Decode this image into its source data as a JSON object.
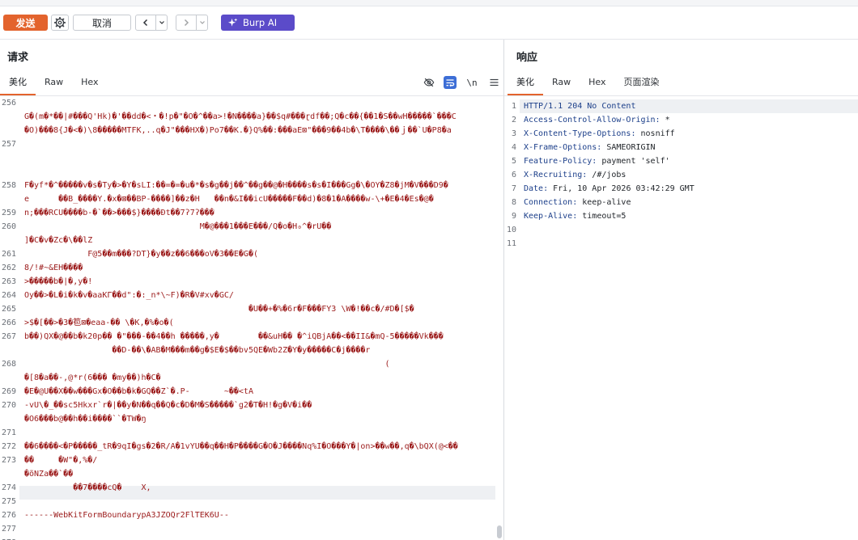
{
  "toolbar": {
    "send_label": "发送",
    "cancel_label": "取消",
    "burp_ai_label": "Burp AI"
  },
  "request": {
    "title": "请求",
    "tabs": [
      {
        "label": "美化",
        "active": true
      },
      {
        "label": "Raw",
        "active": false
      },
      {
        "label": "Hex",
        "active": false
      }
    ],
    "newline_toggle": "\\n",
    "rows": [
      {
        "num": "256",
        "text": ""
      },
      {
        "num": "",
        "text": "G�(m�*��|#���Q'Hk)�'��dd�<・�!p�\"�O�^��a>!�N����a}��$q#���ɽdf��;Q�c��{��1�S��wH�����`���C"
      },
      {
        "num": "",
        "text": "�O)���8{J�<�)\\8�����MTFK,..q�J\"���HX�)Po7��K.�}Q%��:���aE⊠\"���9��4b�\\T����\\��ｊ��`U�P8�a"
      },
      {
        "num": "257",
        "text": ""
      },
      {
        "num": "",
        "text": ""
      },
      {
        "num": "",
        "text": ""
      },
      {
        "num": "258",
        "text": "F�yf*�^�����v�s�Ty�>�Y�sLI:��=�=�u�*�s�g��j��^��g��@�H����s�s�I���Gg�\\�OY�Z8�jM�V���D9�"
      },
      {
        "num": "",
        "text": "e      ��B_����Y.�x�⊠��BP-����]��z�H   ��n�&I��icU�����F��d)�8�1�A����w-\\+�E�4�Es�@�"
      },
      {
        "num": "259",
        "text": "n;���RCU����b-�`��>���$}����Ðt��7ʔ7ʔ���"
      },
      {
        "num": "260",
        "text": "                                    M�@���1���E���/Q�o�H₀^�rU��"
      },
      {
        "num": "",
        "text": "]�C�v�Zc�\\��lZ"
      },
      {
        "num": "261",
        "text": "             F@5��m���?DT}�y��z��6���oV�3��E�G�("
      },
      {
        "num": "262",
        "text": "8/!#~&EH����"
      },
      {
        "num": "263",
        "text": ">�����b�|�,y�!"
      },
      {
        "num": "264",
        "text": "Oy��>�L�i�k�v�aaKΓ��d\":�:_n*\\~F)�R�V#xv�GC/"
      },
      {
        "num": "265",
        "text": "                                              �U��+�%�6r�F���FY3 \\W�!��c�/#D�[$�"
      },
      {
        "num": "266",
        "text": ">$�[��>�3�笣⊠�eaa-�� \\�K,�%�o�("
      },
      {
        "num": "267",
        "text": "b��)QX�@��b�k20p�� �\"���-��4��h �����,y�        ��&uH�� �^iQBjA��<��II&�mQ-5�����Vk���"
      },
      {
        "num": "",
        "text": "                  ��D-��\\�AB�M���m��g�$E�$��bv5QE�Wb2Z�Y�y�����C�j����r"
      },
      {
        "num": "268",
        "text": "                                                                          ("
      },
      {
        "num": "",
        "text": "�[8�a��-,@*r(6��� �my��)h�C�"
      },
      {
        "num": "269",
        "text": "�E�@U��X��w���Gx�O��b�k�GQ��Z`�.P-       ~��<tA"
      },
      {
        "num": "270",
        "text": "-vU\\�_��sc5Hkxr`r�|��y�N��q��Q�c�D�M�S�����`g2�T�H!�g�V�i��"
      },
      {
        "num": "",
        "text": "�O6���b@��h��i����``�TW�ŋ"
      },
      {
        "num": "271",
        "text": ""
      },
      {
        "num": "272",
        "text": "��6����<�P�����_tR�9qI�gs�2�R/A�1vYU��q��H�P����G�O�J����Nq%I�O���Y�|on>��w��,q�\\bQX(@<��"
      },
      {
        "num": "273",
        "text": "��     �W\"�,%�/"
      },
      {
        "num": "",
        "text": "�õNZa��`��"
      },
      {
        "num": "274",
        "text": "          ��7����cQ�    X,"
      },
      {
        "num": "275",
        "text": ""
      },
      {
        "num": "276",
        "text": "------WebKitFormBoundarypA3JZOQr2FlTEK6U--"
      },
      {
        "num": "277",
        "text": ""
      },
      {
        "num": "278",
        "text": ""
      }
    ]
  },
  "response": {
    "title": "响应",
    "tabs": [
      {
        "label": "美化",
        "active": true
      },
      {
        "label": "Raw",
        "active": false
      },
      {
        "label": "Hex",
        "active": false
      },
      {
        "label": "页面渲染",
        "active": false
      }
    ],
    "lines": [
      {
        "num": "1",
        "key": "HTTP/1.1 204 No Content",
        "value": ""
      },
      {
        "num": "2",
        "key": "Access-Control-Allow-Origin:",
        "value": " *"
      },
      {
        "num": "3",
        "key": "X-Content-Type-Options:",
        "value": " nosniff"
      },
      {
        "num": "4",
        "key": "X-Frame-Options:",
        "value": " SAMEORIGIN"
      },
      {
        "num": "5",
        "key": "Feature-Policy:",
        "value": " payment 'self'"
      },
      {
        "num": "6",
        "key": "X-Recruiting:",
        "value": " /#/jobs"
      },
      {
        "num": "7",
        "key": "Date:",
        "value": " Fri, 10 Apr 2026 03:42:29 GMT"
      },
      {
        "num": "8",
        "key": "Connection:",
        "value": " keep-alive"
      },
      {
        "num": "9",
        "key": "Keep-Alive:",
        "value": " timeout=5"
      },
      {
        "num": "10",
        "key": "",
        "value": ""
      },
      {
        "num": "11",
        "key": "",
        "value": ""
      }
    ]
  },
  "colors": {
    "accent_orange": "#e3632d",
    "burp_ai_purple": "#5b4bc9",
    "request_text": "#9b1a1a",
    "header_key": "#1c3f8a"
  }
}
